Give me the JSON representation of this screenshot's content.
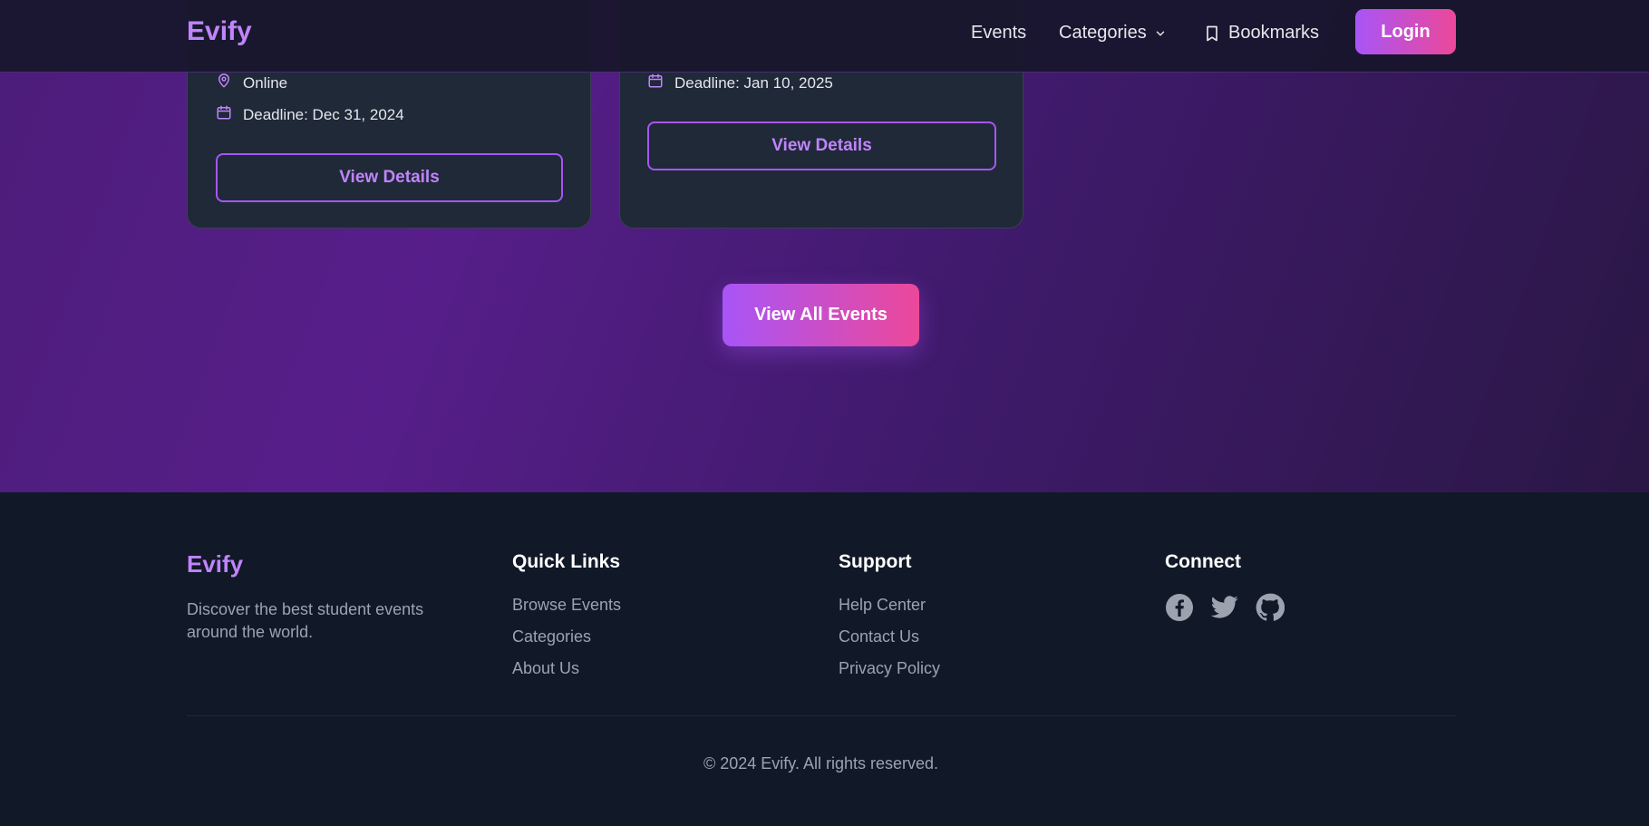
{
  "navbar": {
    "logo": "Evify",
    "links": {
      "events": "Events",
      "categories": "Categories",
      "bookmarks": "Bookmarks"
    },
    "login_label": "Login"
  },
  "cards": [
    {
      "location": "Online",
      "deadline": "Deadline: Dec 31, 2024",
      "button_label": "View Details"
    },
    {
      "deadline": "Deadline: Jan 10, 2025",
      "button_label": "View Details"
    }
  ],
  "view_all_label": "View All Events",
  "footer": {
    "brand": "Evify",
    "description": "Discover the best student events around the world.",
    "quick_links": {
      "title": "Quick Links",
      "items": [
        "Browse Events",
        "Categories",
        "About Us"
      ]
    },
    "support": {
      "title": "Support",
      "items": [
        "Help Center",
        "Contact Us",
        "Privacy Policy"
      ]
    },
    "connect": {
      "title": "Connect",
      "icons": [
        "facebook-icon",
        "twitter-icon",
        "github-icon"
      ]
    },
    "copyright": "© 2024 Evify. All rights reserved."
  },
  "colors": {
    "accent": "#c084fc",
    "gradient_start": "#a855f7",
    "gradient_end": "#ec4899",
    "footer_bg": "#111827",
    "card_bg": "#1f2937"
  }
}
